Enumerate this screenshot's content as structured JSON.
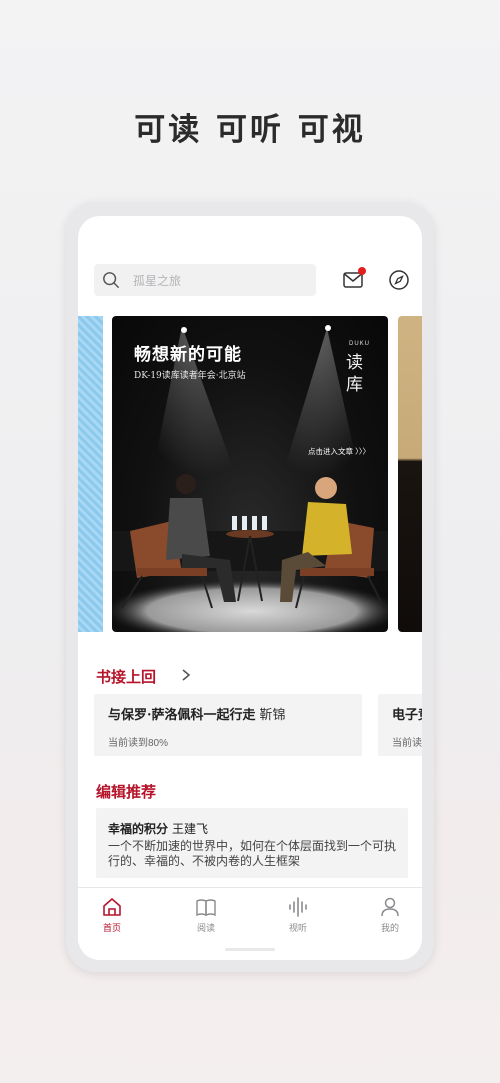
{
  "tagline": "可读 可听 可视",
  "search": {
    "placeholder": "孤星之旅"
  },
  "icons": {
    "search": "search-icon",
    "mail": "mail-icon",
    "compass": "compass-icon"
  },
  "colors": {
    "accent": "#b5142a",
    "badge": "#e02020"
  },
  "banner": {
    "title": "畅想新的可能",
    "subtitle": "DK-19读库读者年会·北京站",
    "brand_en": "DUKU",
    "brand_cn": "读库",
    "cta": "点击进入文章 〉〉〉"
  },
  "continue_section": {
    "title": "书接上回",
    "items": [
      {
        "title": "与保罗·萨洛佩科一起行走",
        "author": "靳锦",
        "progress": "当前读到80%"
      },
      {
        "title": "电子竞",
        "author": "",
        "progress": "当前读"
      }
    ]
  },
  "recommend_section": {
    "title": "编辑推荐",
    "item": {
      "title": "幸福的积分",
      "author": "王建飞",
      "desc": "一个不断加速的世界中，如何在个体层面找到一个可执行的、幸福的、不被内卷的人生框架"
    }
  },
  "tabs": [
    {
      "label": "首页",
      "icon": "home-icon",
      "active": true
    },
    {
      "label": "阅读",
      "icon": "book-icon",
      "active": false
    },
    {
      "label": "视听",
      "icon": "audio-wave-icon",
      "active": false
    },
    {
      "label": "我的",
      "icon": "user-icon",
      "active": false
    }
  ]
}
